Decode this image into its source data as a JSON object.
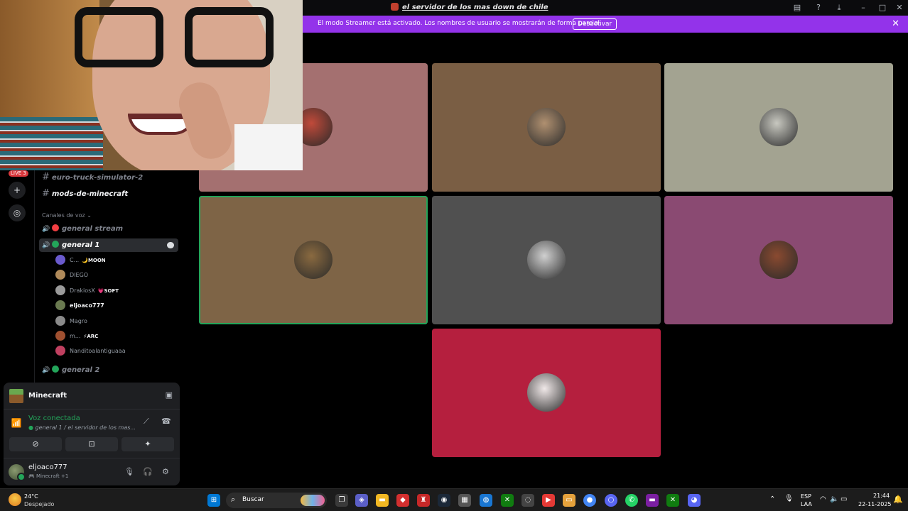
{
  "window": {
    "title": "el servidor de los mas down de chile",
    "controls": [
      "inbox-icon",
      "help-icon",
      "download-icon",
      "minimize-icon",
      "maximize-icon",
      "close-icon"
    ]
  },
  "banner": {
    "message": "El modo Streamer está activado. Los nombres de usuario se mostrarán de forma parcial.",
    "button": "Desactivar",
    "color": "#9333ea"
  },
  "rail": {
    "badge": "LIVE 3"
  },
  "channels": {
    "text": [
      {
        "name": "euro-truck-simulator-2",
        "unread": false
      },
      {
        "name": "mods-de-minecraft",
        "unread": true
      }
    ],
    "voice_category": "Canales de voz",
    "voice": [
      {
        "name": "general stream",
        "status_color": "#f23f43",
        "active": false
      },
      {
        "name": "general 1",
        "status_color": "#23a55a",
        "active": true
      },
      {
        "name": "general 2",
        "status_color": "#23a55a",
        "active": false
      }
    ],
    "members": [
      {
        "name": "C...",
        "tag": "MOON",
        "tag_icon": "🌙",
        "bold": false,
        "color": "#6a5acd"
      },
      {
        "name": "DIEGO",
        "tag": "",
        "tag_icon": "",
        "bold": false,
        "color": "#b08a5a"
      },
      {
        "name": "DrakiosX",
        "tag": "SOFT",
        "tag_icon": "💗",
        "bold": false,
        "color": "#9a9a9a"
      },
      {
        "name": "eljoaco777",
        "tag": "",
        "tag_icon": "",
        "bold": true,
        "color": "#6a7a50"
      },
      {
        "name": "Magro",
        "tag": "",
        "tag_icon": "",
        "bold": false,
        "color": "#8a8a8a"
      },
      {
        "name": "m...",
        "tag": "ARC",
        "tag_icon": "⚡",
        "bold": false,
        "color": "#a05030"
      },
      {
        "name": "Nanditoalantiguaaa",
        "tag": "",
        "tag_icon": "",
        "bold": false,
        "color": "#c04060"
      }
    ]
  },
  "panel": {
    "activity": "Minecraft",
    "voice_state": "Voz conectada",
    "voice_location": "general 1 / el servidor de los mas...",
    "user": "eljoaco777",
    "user_status": "Minecraft +1"
  },
  "tiles": [
    {
      "bg": "#a47070",
      "pfp": "#c04a3a",
      "speaking": false
    },
    {
      "bg": "#7a5e44",
      "pfp": "#b09070",
      "speaking": false
    },
    {
      "bg": "#a3a391",
      "pfp": "#c8c8c0",
      "speaking": false
    },
    {
      "bg": "#7e6446",
      "pfp": "#8a6a40",
      "speaking": true
    },
    {
      "bg": "#505050",
      "pfp": "#d0d0d0",
      "speaking": false
    },
    {
      "bg": "#8a4a72",
      "pfp": "#8a4a30",
      "speaking": false
    },
    {
      "bg": "#b51f3e",
      "pfp": "#f0e8e8",
      "speaking": false
    }
  ],
  "taskbar": {
    "temp": "24°C",
    "weather": "Despejado",
    "search": "Buscar",
    "lang_top": "ESP",
    "lang_bottom": "LAA",
    "time": "21:44",
    "date": "22-11-2025"
  }
}
